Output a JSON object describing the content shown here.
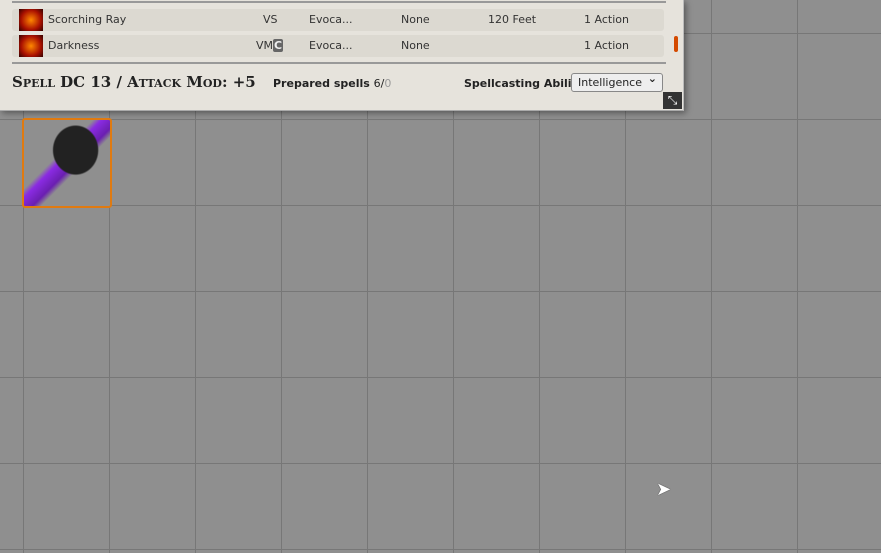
{
  "spells": [
    {
      "name": "Scorching Ray",
      "components": "VS",
      "concentration": "",
      "school": "Evoca...",
      "save": "None",
      "range": "120 Feet",
      "time": "1 Action"
    },
    {
      "name": "Darkness",
      "components": "VM",
      "concentration": "C",
      "school": "Evoca...",
      "save": "None",
      "range": "",
      "time": "1 Action"
    }
  ],
  "footer": {
    "dc_label": "Spell DC 13 / Attack Mod: +5",
    "prepared_label": "Prepared spells",
    "prepared_count": "6/",
    "prepared_max": "0",
    "ability_label": "Spellcasting Ability",
    "ability_value": "Intelligence"
  },
  "resize_icon": "⤡"
}
